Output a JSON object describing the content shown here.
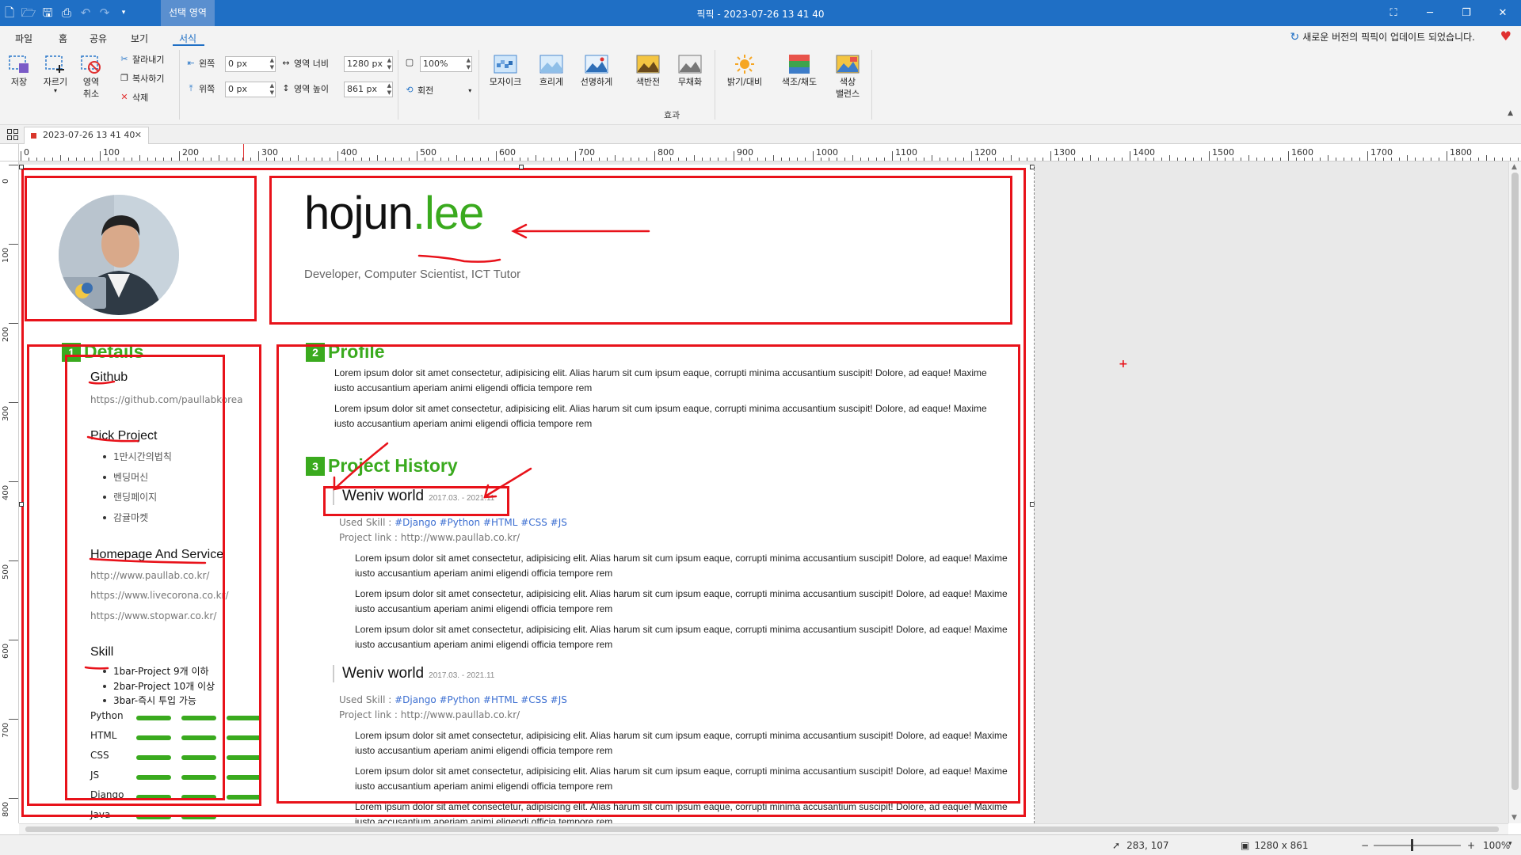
{
  "window": {
    "title": "픽픽 - 2023-07-26 13 41 40",
    "context_tab": "선택 영역"
  },
  "menu": {
    "items": [
      "파일",
      "홈",
      "공유",
      "보기",
      "서식"
    ],
    "active": "서식",
    "notice": "새로운 버전의 픽픽이 업데이트 되었습니다."
  },
  "ribbon": {
    "save": "저장",
    "crop": "자르기",
    "cancel_line1": "영역",
    "cancel_line2": "취소",
    "cut": "잘라내기",
    "copy": "복사하기",
    "delete": "삭제",
    "left_label": "왼쪽",
    "left_value": "0 px",
    "top_label": "위쪽",
    "top_value": "0 px",
    "width_label": "영역 너비",
    "width_value": "1280 px",
    "height_label": "영역 높이",
    "height_value": "861 px",
    "zoom_value": "100%",
    "rotate": "회전",
    "effects": [
      "모자이크",
      "흐리게",
      "선명하게",
      "색반전",
      "무채화"
    ],
    "brightness": "밝기/대비",
    "hue": "색조/채도",
    "balance_line1": "색상",
    "balance_line2": "밸런스",
    "group_effects": "효과"
  },
  "doc_tab": {
    "label": "2023-07-26 13 41 40"
  },
  "ruler": {
    "h_ticks": [
      "0",
      "100",
      "200",
      "300",
      "400",
      "500",
      "600",
      "700",
      "800",
      "900",
      "1000",
      "1100",
      "1200",
      "1300",
      "1400",
      "1500",
      "1600",
      "1700",
      "1800"
    ],
    "v_ticks": [
      "0",
      "100",
      "200",
      "300",
      "400",
      "500",
      "600",
      "700",
      "800"
    ]
  },
  "status": {
    "cursor": "283, 107",
    "size": "1280 x 861",
    "zoom": "100%"
  },
  "resume": {
    "name_first": "hojun",
    "name_second": ".lee",
    "subtitle": "Developer, Computer Scientist, ICT Tutor",
    "sections": {
      "details": {
        "num": "1",
        "title": "Details"
      },
      "profile": {
        "num": "2",
        "title": "Profile"
      },
      "history": {
        "num": "3",
        "title": "Project History"
      }
    },
    "github": {
      "title": "Github",
      "url": "https://github.com/paullabkorea"
    },
    "pick": {
      "title": "Pick Project",
      "items": [
        "1만시간의법칙",
        "벤딩머신",
        "랜딩페이지",
        "감귤마켓"
      ]
    },
    "homepage": {
      "title": "Homepage And Service",
      "links": [
        "http://www.paullab.co.kr/",
        "https://www.livecorona.co.kr/",
        "https://www.stopwar.co.kr/"
      ]
    },
    "skill": {
      "title": "Skill",
      "legend": [
        "1bar-Project 9개 이하",
        "2bar-Project 10개 이상",
        "3bar-즉시 투입 가능"
      ],
      "items": [
        {
          "name": "Python",
          "bars": 3
        },
        {
          "name": "HTML",
          "bars": 3
        },
        {
          "name": "CSS",
          "bars": 3
        },
        {
          "name": "JS",
          "bars": 3
        },
        {
          "name": "Django",
          "bars": 3
        },
        {
          "name": "Java",
          "bars": 2
        }
      ]
    },
    "profile_text": [
      "Lorem ipsum dolor sit amet consectetur, adipisicing elit. Alias harum sit cum ipsum eaque, corrupti minima accusantium suscipit! Dolore, ad eaque! Maxime iusto accusantium aperiam animi eligendi officia tempore rem",
      "Lorem ipsum dolor sit amet consectetur, adipisicing elit. Alias harum sit cum ipsum eaque, corrupti minima accusantium suscipit! Dolore, ad eaque! Maxime iusto accusantium aperiam animi eligendi officia tempore rem"
    ],
    "projects": [
      {
        "title": "Weniv world",
        "date": "2017.03. - 2021.11",
        "skill_label": "Used Skill :",
        "skills": "#Django #Python #HTML #CSS #JS",
        "link_label": "Project link :",
        "link": "http://www.paullab.co.kr/",
        "paras": [
          "Lorem ipsum dolor sit amet consectetur, adipisicing elit. Alias harum sit cum ipsum eaque, corrupti minima accusantium suscipit! Dolore, ad eaque! Maxime iusto accusantium aperiam animi eligendi officia tempore rem",
          "Lorem ipsum dolor sit amet consectetur, adipisicing elit. Alias harum sit cum ipsum eaque, corrupti minima accusantium suscipit! Dolore, ad eaque! Maxime iusto accusantium aperiam animi eligendi officia tempore rem",
          "Lorem ipsum dolor sit amet consectetur, adipisicing elit. Alias harum sit cum ipsum eaque, corrupti minima accusantium suscipit! Dolore, ad eaque! Maxime iusto accusantium aperiam animi eligendi officia tempore rem"
        ]
      },
      {
        "title": "Weniv world",
        "date": "2017.03. - 2021.11",
        "skill_label": "Used Skill :",
        "skills": "#Django #Python #HTML #CSS #JS",
        "link_label": "Project link :",
        "link": "http://www.paullab.co.kr/",
        "paras": [
          "Lorem ipsum dolor sit amet consectetur, adipisicing elit. Alias harum sit cum ipsum eaque, corrupti minima accusantium suscipit! Dolore, ad eaque! Maxime iusto accusantium aperiam animi eligendi officia tempore rem",
          "Lorem ipsum dolor sit amet consectetur, adipisicing elit. Alias harum sit cum ipsum eaque, corrupti minima accusantium suscipit! Dolore, ad eaque! Maxime iusto accusantium aperiam animi eligendi officia tempore rem",
          "Lorem ipsum dolor sit amet consectetur, adipisicing elit. Alias harum sit cum ipsum eaque, corrupti minima accusantium suscipit! Dolore, ad eaque! Maxime iusto accusantium aperiam animi eligendi officia tempore rem"
        ]
      }
    ]
  },
  "colors": {
    "accent": "#3aaa1e",
    "annotation": "#e8121a",
    "titlebar": "#1f6fc5"
  }
}
